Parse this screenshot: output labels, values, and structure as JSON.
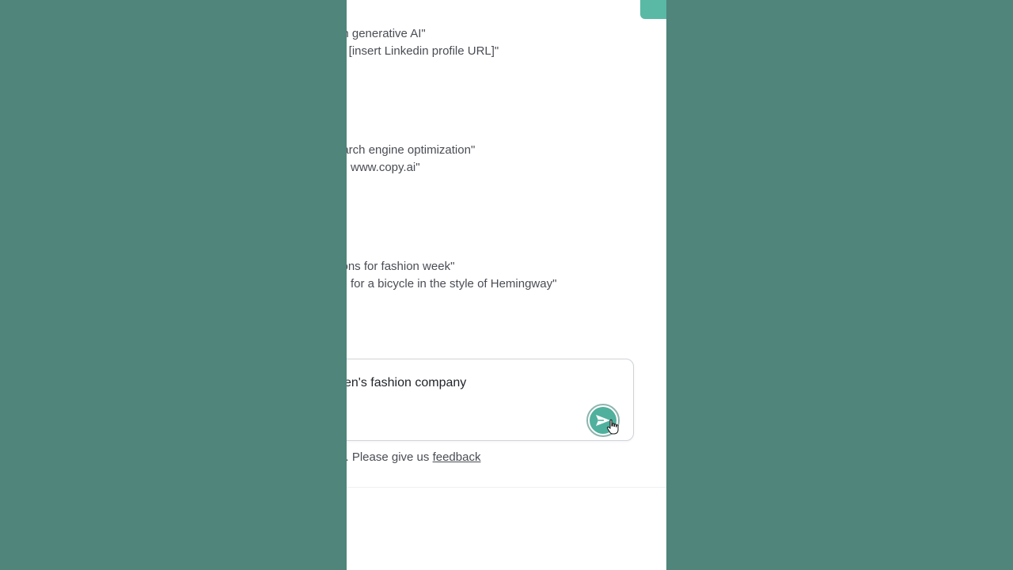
{
  "examples": [
    {
      "line1": "on generative AI\"",
      "line2": "to [insert Linkedin profile URL]\""
    },
    {
      "line1": "earch engine optimization\"",
      "line2": "www.copy.ai\""
    },
    {
      "line1": "tions for fashion week\"",
      "line2": "for a bicycle in the style of Hemingway\""
    }
  ],
  "composer": {
    "value": "en's fashion company",
    "send_icon": "send-arrow-icon"
  },
  "footer": {
    "text": "ta. Please give us ",
    "link_label": "feedback"
  },
  "colors": {
    "backdrop": "#4f857b",
    "accent": "#4fb09d",
    "text": "#4a4d54"
  }
}
